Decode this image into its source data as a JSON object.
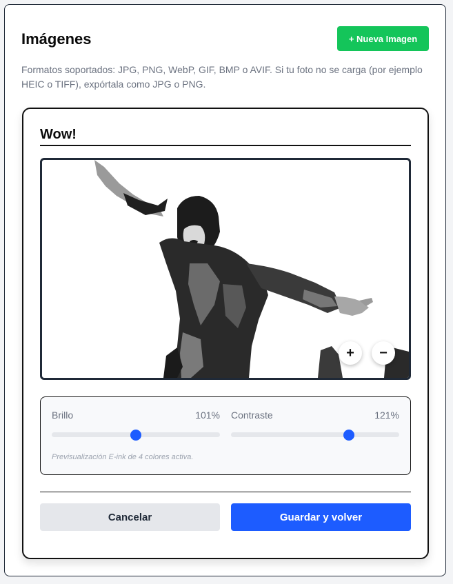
{
  "header": {
    "title": "Imágenes",
    "new_button": "+ Nueva Imagen"
  },
  "description": "Formatos soportados: JPG, PNG, WebP, GIF, BMP o AVIF. Si tu foto no se carga (por ejemplo HEIC o TIFF), expórtala como JPG o PNG.",
  "editor": {
    "image_title": "Wow!",
    "zoom_in_symbol": "+",
    "zoom_out_symbol": "−",
    "brightness": {
      "label": "Brillo",
      "value_text": "101%",
      "level": 0.5
    },
    "contrast": {
      "label": "Contraste",
      "value_text": "121%",
      "level": 0.7
    },
    "hint": "Previsualización E-ink de 4 colores activa.",
    "cancel_label": "Cancelar",
    "save_label": "Guardar y volver"
  },
  "colors": {
    "accent_green": "#14c55a",
    "accent_blue": "#1d5cff"
  }
}
